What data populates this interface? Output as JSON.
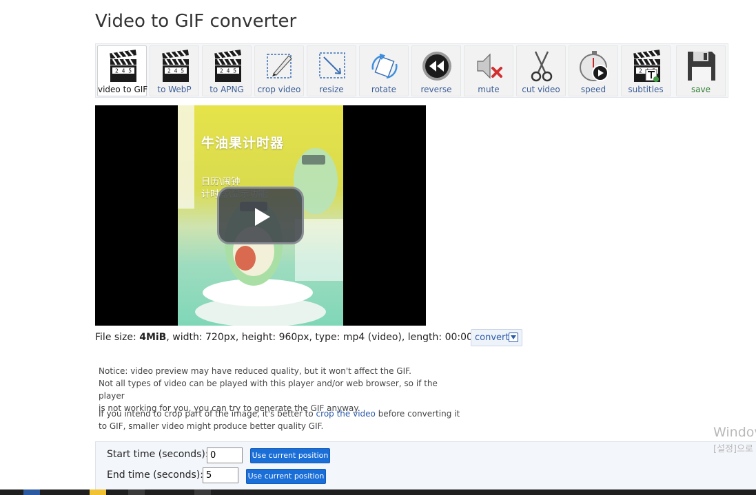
{
  "page_title": "Video to GIF converter",
  "toolbar": [
    {
      "label": "video to GIF",
      "icon": "clapperboard-icon",
      "active": true
    },
    {
      "label": "to WebP",
      "icon": "clapperboard-icon",
      "active": false
    },
    {
      "label": "to APNG",
      "icon": "clapperboard-icon",
      "active": false
    },
    {
      "label": "crop video",
      "icon": "crop-icon",
      "active": false
    },
    {
      "label": "resize",
      "icon": "resize-icon",
      "active": false
    },
    {
      "label": "rotate",
      "icon": "rotate-icon",
      "active": false
    },
    {
      "label": "reverse",
      "icon": "rewind-icon",
      "active": false
    },
    {
      "label": "mute",
      "icon": "mute-speaker-icon",
      "active": false
    },
    {
      "label": "cut video",
      "icon": "scissors-icon",
      "active": false
    },
    {
      "label": "speed",
      "icon": "stopwatch-play-icon",
      "active": false
    },
    {
      "label": "subtitles",
      "icon": "clapperboard-text-icon",
      "active": false
    },
    {
      "label": "save",
      "icon": "floppy-disk-icon",
      "active": false
    }
  ],
  "clapper_digits": "2 4 5",
  "video": {
    "title_overlay": "牛油果计时器",
    "line1": "日历\\闹钟",
    "line2": "计时器\\显示功能"
  },
  "file_info": {
    "prefix": "File size: ",
    "size": "4MiB",
    "details": ", width: 720px, height: 960px, type: mp4 (video), length: 00:00:43",
    "convert_label": "convert"
  },
  "notice": {
    "line1": "Notice: video preview may have reduced quality, but it won't affect the GIF.",
    "line2": "Not all types of video can be played with this player and/or web browser, so if the player",
    "line3": "is not working for you, you can try to generate the GIF anyway.",
    "crop_pre": "If you intend to crop part of the image, it's better to ",
    "crop_link": "crop the video",
    "crop_post": " before converting it",
    "crop_line2": "to GIF, smaller video might produce better quality GIF."
  },
  "time": {
    "start_label": "Start time (seconds):",
    "start_value": "0",
    "end_label": "End time (seconds):",
    "end_value": "5",
    "use_current_label": "Use current position"
  },
  "watermark": {
    "line1": "Windov",
    "line2": "[설정]으로"
  },
  "colors": {
    "accent": "#1a6ed8",
    "link": "#2a5aa8",
    "save_green": "#2e7d32"
  }
}
